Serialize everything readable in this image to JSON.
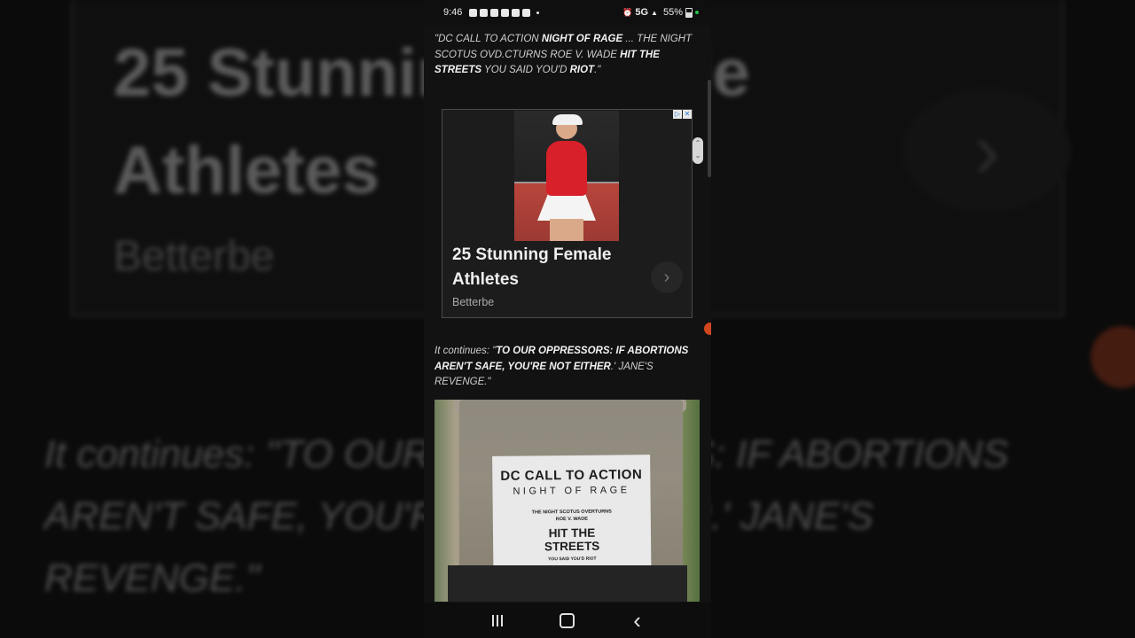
{
  "status_bar": {
    "time": "9:46",
    "network": "5G",
    "battery": "55%"
  },
  "article": {
    "quote1": {
      "segments": [
        {
          "text": "\"DC CALL TO ACTION ",
          "bold": false
        },
        {
          "text": "NIGHT OF RAGE",
          "bold": true
        },
        {
          "text": " ... THE NIGHT SCOTUS OVD.CTURNS ROE V. WADE ",
          "bold": false
        },
        {
          "text": "HIT THE STREETS",
          "bold": true
        },
        {
          "text": " YOU SAID YOU'D ",
          "bold": false
        },
        {
          "text": "RIOT",
          "bold": true
        },
        {
          "text": ".\"",
          "bold": false
        }
      ]
    },
    "quote2": {
      "segments": [
        {
          "text": "It continues: \"",
          "bold": false
        },
        {
          "text": "TO OUR OPPRESSORS: IF ABORTIONS AREN'T SAFE, YOU'RE NOT EITHER",
          "bold": true
        },
        {
          "text": ".' JANE'S REVENGE.\"",
          "bold": false
        }
      ]
    }
  },
  "ad": {
    "title": "25 Stunning Female Athletes",
    "source": "Betterbe",
    "chevron": "›",
    "adchoices_label": "▷",
    "close_label": "✕"
  },
  "background": {
    "ad_title": "25 Stunning Female Athletes",
    "ad_source": "Betterbe",
    "quote": "It continues: \"TO OUR OPPRESSORS: IF ABORTIONS AREN'T SAFE, YOU'RE NOT EITHER.' JANE'S REVENGE.\""
  },
  "photo": {
    "flyer_line1": "DC CALL TO ACTION",
    "flyer_line2": "NIGHT OF RAGE",
    "flyer_small1": "THE NIGHT SCOTUS OVERTURNS",
    "flyer_small2": "ROE V. WADE",
    "flyer_line3a": "HIT THE",
    "flyer_line3b": "STREETS",
    "flyer_tiny": "YOU SAID YOU'D RIOT"
  },
  "nav": {
    "back_glyph": "‹"
  },
  "colors": {
    "accent_orange": "#d0461e",
    "status_green": "#25c04a"
  }
}
